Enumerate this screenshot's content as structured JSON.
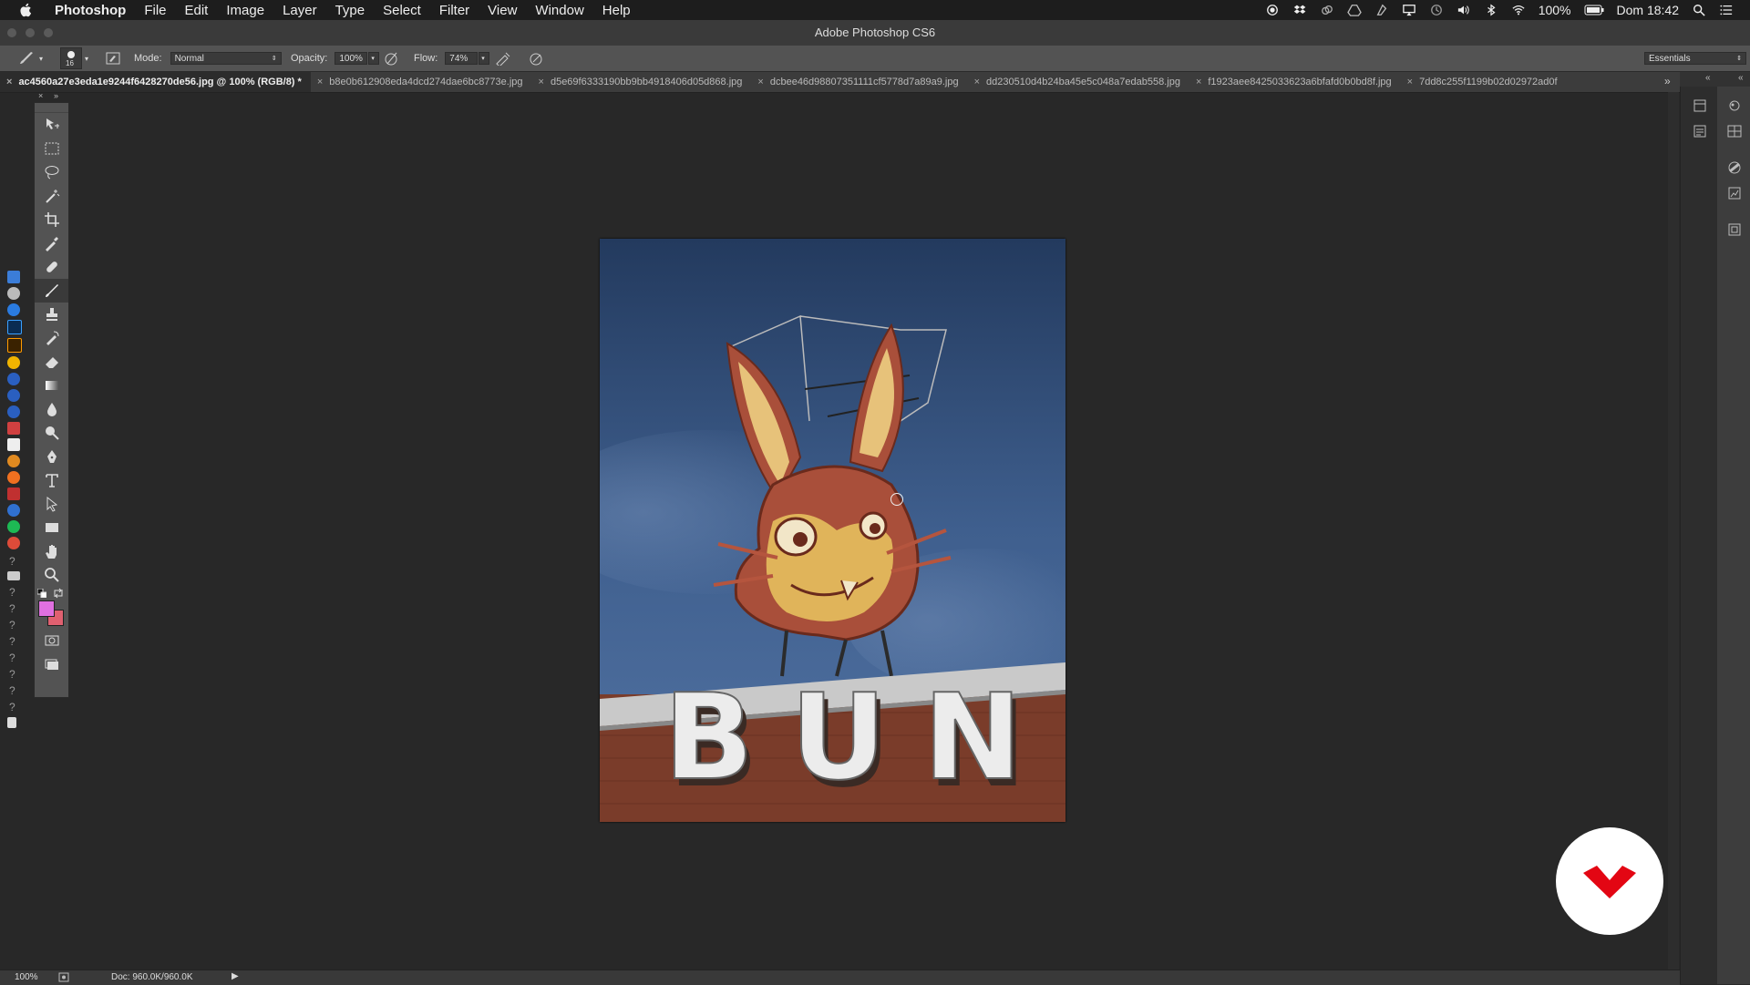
{
  "menubar": {
    "app": "Photoshop",
    "items": [
      "File",
      "Edit",
      "Image",
      "Layer",
      "Type",
      "Select",
      "Filter",
      "View",
      "Window",
      "Help"
    ],
    "battery": "100%",
    "clock": "Dom 18:42"
  },
  "window": {
    "title": "Adobe Photoshop CS6"
  },
  "options": {
    "brush_size": "16",
    "mode_label": "Mode:",
    "mode_value": "Normal",
    "opacity_label": "Opacity:",
    "opacity_value": "100%",
    "flow_label": "Flow:",
    "flow_value": "74%",
    "workspace": "Essentials"
  },
  "tabs": [
    {
      "label": "ac4560a27e3eda1e9244f6428270de56.jpg @ 100% (RGB/8) *"
    },
    {
      "label": "b8e0b612908eda4dcd274dae6bc8773e.jpg"
    },
    {
      "label": "d5e69f6333190bb9bb4918406d05d868.jpg"
    },
    {
      "label": "dcbee46d98807351111cf5778d7a89a9.jpg"
    },
    {
      "label": "dd230510d4b24ba45e5c048a7edab558.jpg"
    },
    {
      "label": "f1923aee8425033623a6bfafd0b0bd8f.jpg"
    },
    {
      "label": "7dd8c255f1199b02d02972ad0f"
    }
  ],
  "canvas": {
    "sign_text": "BUN"
  },
  "status": {
    "zoom": "100%",
    "doc": "Doc: 960.0K/960.0K"
  },
  "colors": {
    "foreground": "#e070e0",
    "background": "#e06070",
    "accent": "#e30613"
  }
}
